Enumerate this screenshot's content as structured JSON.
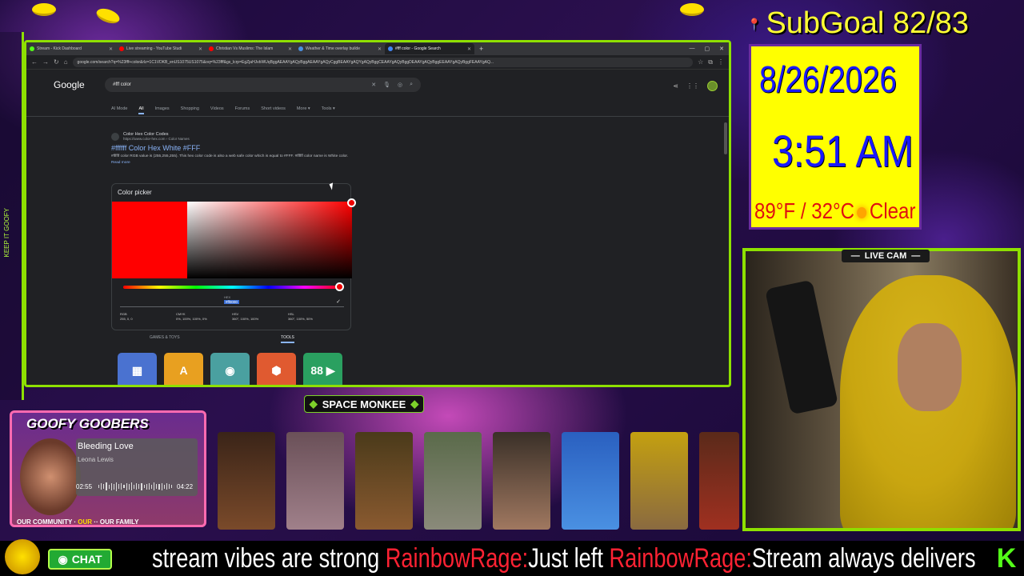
{
  "browser": {
    "tabs": [
      {
        "label": "Stream - Kick Dashboard",
        "color": "#53fc18"
      },
      {
        "label": "Live streaming - YouTube Studi",
        "color": "#ff0000"
      },
      {
        "label": "Christian Vs Muslims: The Islam",
        "color": "#ff0000"
      },
      {
        "label": "Weather & Time overlay builde",
        "color": "#4a90e2"
      },
      {
        "label": "#fff color - Google Search",
        "color": "#4285f4"
      }
    ],
    "url": "google.com/search?q=%23fff+color&rlz=1C1VDKB_enUS1075US1075&oq=%23fff&gs_lcrp=EgZjaHJvbWUqBggAEAAYgAQyBggAEAAYgAQyCggBEAAYgAQYgAQyBggCEAAYgAQyBggDEAAYgAQyBggEEAAYgAQyBggFEAAYgAQ...",
    "google_logo": "Google",
    "search_value": "#fff color",
    "nav_tabs": [
      "AI Mode",
      "All",
      "Images",
      "Shopping",
      "Videos",
      "Forums",
      "Short videos",
      "More ▾",
      "Tools ▾"
    ],
    "result": {
      "site_name": "Color Hex Color Codes",
      "cite": "https://www.color-hex.com › Color Names",
      "title": "#ffffff Color Hex White #FFF",
      "snippet": "#ffffff color RGB value is (255,255,255). This hex color code is also a web safe color which is equal to #FFF. #ffffff color name is White color.",
      "read_more": "Read more"
    },
    "picker": {
      "title": "Color picker",
      "hex_label": "HEX",
      "hex_value": "#ff0000",
      "values": [
        {
          "label": "RGB",
          "value": "255, 0, 0"
        },
        {
          "label": "CMYK",
          "value": "0%, 100%, 100%, 0%"
        },
        {
          "label": "HSV",
          "value": "360°, 100%, 100%"
        },
        {
          "label": "HSL",
          "value": "360°, 100%, 50%"
        }
      ],
      "groups": [
        "GAMES & TOYS",
        "TOOLS"
      ],
      "selected_color": "#ff0000"
    },
    "apps": [
      {
        "name": "calculator",
        "glyph": "▦",
        "bg": "#4a72d0"
      },
      {
        "name": "translate",
        "glyph": "A",
        "bg": "#e8a020"
      },
      {
        "name": "earth",
        "glyph": "◉",
        "bg": "#4aa0a0"
      },
      {
        "name": "dice",
        "glyph": "⬢",
        "bg": "#e05a30"
      },
      {
        "name": "metronome",
        "glyph": "88 ▶",
        "bg": "#2aa060"
      }
    ]
  },
  "overlay": {
    "subgoal": "SubGoal 82/83",
    "date": "8/26/2026",
    "time": "3:51 AM",
    "weather": {
      "temp": "89°F / 32°C",
      "condition": "Clear"
    },
    "live_cam_label": "LIVE CAM",
    "space_monkee": "SPACE MONKEE",
    "goofy": {
      "title": "GOOFY GOOBERS",
      "song": "Bleeding Love",
      "artist": "Leona Lewis",
      "elapsed": "02:55",
      "duration": "04:22",
      "community_a": "OUR COMMUNITY",
      "community_b": "OUR",
      "community_c": "OUR FAMILY"
    },
    "chat_label": "CHAT",
    "ticker": [
      {
        "text": "stream vibes are strong ",
        "rr": false
      },
      {
        "text": "RainbowRage:",
        "rr": true
      },
      {
        "text": "Just left ",
        "rr": false
      },
      {
        "text": "RainbowRage:",
        "rr": true
      },
      {
        "text": "Stream always delivers",
        "rr": false
      }
    ],
    "side_text": "KEEP IT GOOFY",
    "kick_logo": "K"
  }
}
